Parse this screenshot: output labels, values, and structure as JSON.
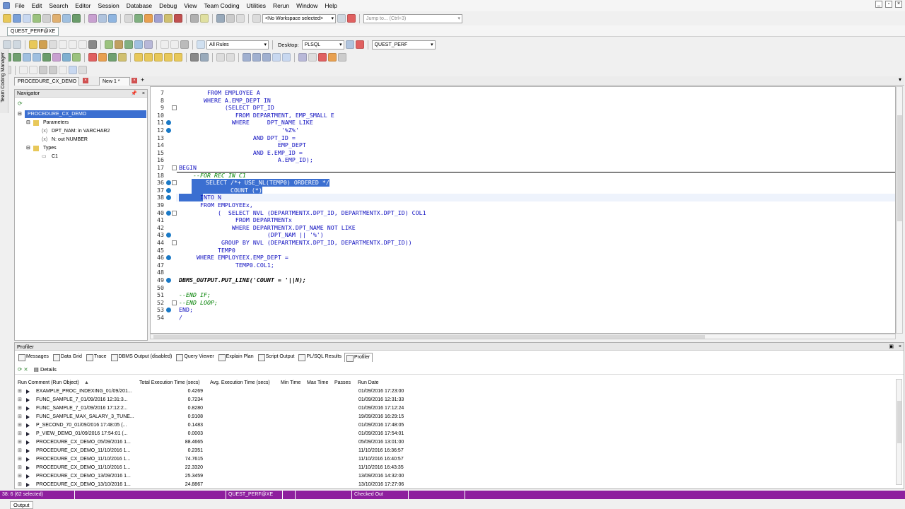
{
  "menu": [
    "File",
    "Edit",
    "Search",
    "Editor",
    "Session",
    "Database",
    "Debug",
    "View",
    "Team Coding",
    "Utilities",
    "Rerun",
    "Window",
    "Help"
  ],
  "toolbar": {
    "workspace": "<No Workspace selected>",
    "jump_placeholder": "Jump to... (Ctrl+3)",
    "rules": "All Rules",
    "desktop_label": "Desktop:",
    "desktop_value": "PLSQL",
    "connection_combo": "QUEST_PERF"
  },
  "connection_tab": "QUEST_PERF@XE",
  "team_coding_manager": "Team Coding Manager",
  "editor_tabs": [
    "PROCEDURE_CX_DEMO",
    "New 1 *"
  ],
  "navigator": {
    "title": "Navigator",
    "nodes": [
      "PROCEDURE_CX_DEMO",
      "Parameters",
      "DPT_NAM: in VARCHAR2",
      "N: out NUMBER",
      "Types",
      "C1"
    ]
  },
  "code": {
    "lines": [
      {
        "n": "7",
        "t": "        FROM EMPLOYEE A"
      },
      {
        "n": "8",
        "t": "       WHERE A.EMP_DEPT IN"
      },
      {
        "n": "9",
        "t": "             (SELECT DPT_ID"
      },
      {
        "n": "10",
        "t": "                FROM DEPARTMENT, EMP_SMALL E"
      },
      {
        "n": "11",
        "t": "               WHERE     DPT_NAME LIKE"
      },
      {
        "n": "12",
        "t": "                             '%Z%'"
      },
      {
        "n": "13",
        "t": "                     AND DPT_ID ="
      },
      {
        "n": "14",
        "t": "                            EMP_DEPT"
      },
      {
        "n": "15",
        "t": "                     AND E.EMP_ID ="
      },
      {
        "n": "16",
        "t": "                            A.EMP_ID);"
      },
      {
        "n": "17",
        "t": "BEGIN"
      },
      {
        "n": "18",
        "t": "    --FOR REC IN C1"
      },
      {
        "n": "36",
        "t": "    SELECT /*+ USE_NL(TEMP0) ORDERED */"
      },
      {
        "n": "37",
        "t": "           COUNT (*)"
      },
      {
        "n": "38",
        "t": "      INTO N"
      },
      {
        "n": "39",
        "t": "      FROM EMPLOYEEx,"
      },
      {
        "n": "40",
        "t": "           (  SELECT NVL (DEPARTMENTX.DPT_ID, DEPARTMENTX.DPT_ID) COL1"
      },
      {
        "n": "41",
        "t": "                FROM DEPARTMENTx"
      },
      {
        "n": "42",
        "t": "               WHERE DEPARTMENTX.DPT_NAME NOT LIKE"
      },
      {
        "n": "43",
        "t": "                         (DPT_NAM || '%')"
      },
      {
        "n": "44",
        "t": "            GROUP BY NVL (DEPARTMENTX.DPT_ID, DEPARTMENTX.DPT_ID))"
      },
      {
        "n": "45",
        "t": "           TEMP0"
      },
      {
        "n": "46",
        "t": "     WHERE EMPLOYEEX.EMP_DEPT ="
      },
      {
        "n": "47",
        "t": "                TEMP0.COL1;"
      },
      {
        "n": "48",
        "t": ""
      },
      {
        "n": "49",
        "t": "DBMS_OUTPUT.PUT_LINE('COUNT = '||N);"
      },
      {
        "n": "50",
        "t": ""
      },
      {
        "n": "51",
        "t": "--END IF;"
      },
      {
        "n": "52",
        "t": "--END LOOP;"
      },
      {
        "n": "53",
        "t": "END;"
      },
      {
        "n": "54",
        "t": "/"
      }
    ]
  },
  "profiler": {
    "title": "Profiler",
    "tabs": [
      "Messages",
      "Data Grid",
      "Trace",
      "DBMS Output (disabled)",
      "Query Viewer",
      "Explain Plan",
      "Script Output",
      "PL/SQL Results",
      "Profiler"
    ],
    "details_label": "Details",
    "columns": [
      "Run Comment (Run Object)",
      "Total Execution Time (secs)",
      "Avg. Execution Time (secs)",
      "Min Time",
      "Max Time",
      "Passes",
      "Run Date"
    ],
    "rows": [
      {
        "comment": "EXAMPLE_PROC_INDEXING_01/09/201...",
        "total": "0.4269",
        "date": "01/09/2016 17:23:00"
      },
      {
        "comment": "FUNC_SAMPLE_7_01/09/2016 12:31:3...",
        "total": "0.7234",
        "date": "01/09/2016 12:31:33"
      },
      {
        "comment": "FUNC_SAMPLE_7_01/09/2016 17:12:2...",
        "total": "0.8280",
        "date": "01/09/2016 17:12:24"
      },
      {
        "comment": "FUNC_SAMPLE_MAX_SALARY_3_TUNE...",
        "total": "0.9108",
        "date": "19/09/2016 16:29:15"
      },
      {
        "comment": "P_SECOND_70_01/09/2016 17:48:05 (...",
        "total": "0.1483",
        "date": "01/09/2016 17:48:05"
      },
      {
        "comment": "P_VIEW_DEMO_01/09/2016 17:54:01 (...",
        "total": "0.0003",
        "date": "01/09/2016 17:54:01"
      },
      {
        "comment": "PROCEDURE_CX_DEMO_05/09/2016 1...",
        "total": "88.4665",
        "date": "05/09/2016 13:01:00"
      },
      {
        "comment": "PROCEDURE_CX_DEMO_11/10/2016 1...",
        "total": "0.2351",
        "date": "11/10/2016 16:36:57"
      },
      {
        "comment": "PROCEDURE_CX_DEMO_11/10/2016 1...",
        "total": "74.7615",
        "date": "11/10/2016 16:40:57"
      },
      {
        "comment": "PROCEDURE_CX_DEMO_11/10/2016 1...",
        "total": "22.3320",
        "date": "11/10/2016 16:43:35"
      },
      {
        "comment": "PROCEDURE_CX_DEMO_13/09/2016 1...",
        "total": "25.3459",
        "date": "13/09/2016 14:32:00"
      },
      {
        "comment": "PROCEDURE_CX_DEMO_13/10/2016 1...",
        "total": "24.8867",
        "date": "13/10/2016 17:27:06"
      }
    ]
  },
  "status": {
    "position": "38:  6  (62 selected)",
    "connection": "QUEST_PERF@XE",
    "checkout": "Checked Out"
  },
  "output_tab": "Output",
  "colors": {
    "status_bar": "#8e1f9e",
    "selection": "#3b6fd1",
    "keyword": "#1010c0"
  }
}
